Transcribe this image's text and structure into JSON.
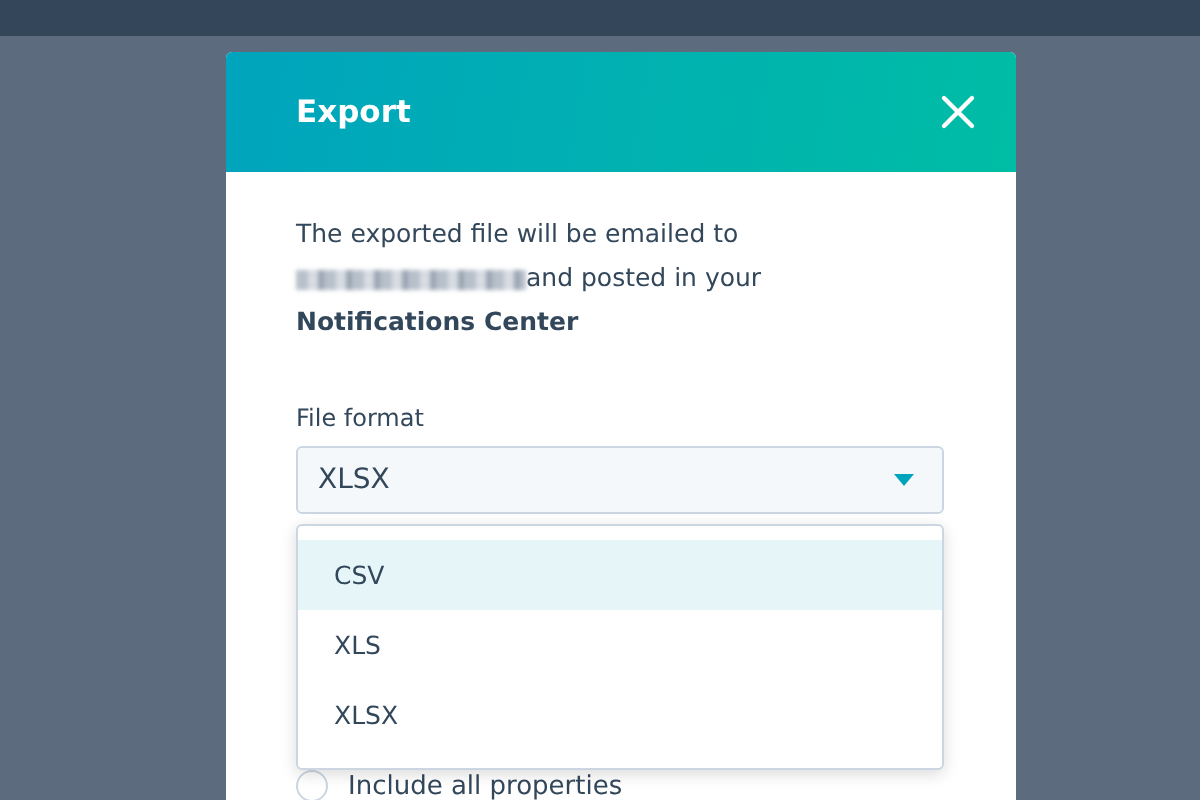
{
  "dialog": {
    "title": "Export",
    "message_before": "The exported file will be emailed to",
    "message_after": "and posted in your",
    "message_bold": "Notifications Center",
    "file_format": {
      "label": "File format",
      "value": "XLSX",
      "expanded": true,
      "options": [
        {
          "label": "CSV",
          "highlighted": true
        },
        {
          "label": "XLS",
          "highlighted": false
        },
        {
          "label": "XLSX",
          "highlighted": false
        }
      ]
    },
    "radio": {
      "label": "Include all properties",
      "checked": false
    }
  }
}
